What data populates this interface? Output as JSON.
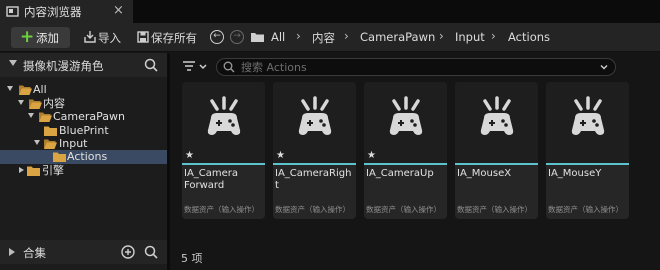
{
  "window": {
    "tab_title": "内容浏览器",
    "tab_icon": "content-browser-icon",
    "close_glyph": "×"
  },
  "toolbar": {
    "add_label": "添加",
    "import_label": "导入",
    "save_all_label": "保存所有",
    "breadcrumbs": [
      "All",
      "内容",
      "CameraPawn",
      "Input",
      "Actions"
    ]
  },
  "sidebar": {
    "title": "摄像机漫游角色",
    "tree": [
      {
        "label": "All",
        "depth": 0,
        "expanded": true,
        "selected": false
      },
      {
        "label": "内容",
        "depth": 1,
        "expanded": true,
        "selected": false
      },
      {
        "label": "CameraPawn",
        "depth": 2,
        "expanded": true,
        "selected": false
      },
      {
        "label": "BluePrint",
        "depth": 3,
        "expanded": null,
        "selected": false
      },
      {
        "label": "Input",
        "depth": 3,
        "expanded": true,
        "selected": false
      },
      {
        "label": "Actions",
        "depth": 4,
        "expanded": null,
        "selected": true
      },
      {
        "label": "引擎",
        "depth": 1,
        "expanded": false,
        "selected": false
      }
    ],
    "footer_title": "合集"
  },
  "content": {
    "search_placeholder": "搜索 Actions",
    "assets": [
      {
        "name": "IA_Camera Forward",
        "type": "数据资产（输入操作）",
        "starred": true
      },
      {
        "name": "IA_CameraRight",
        "type": "数据资产（输入操作）",
        "starred": true
      },
      {
        "name": "IA_CameraUp",
        "type": "数据资产（输入操作）",
        "starred": true
      },
      {
        "name": "IA_MouseX",
        "type": "数据资产（输入操作）",
        "starred": false
      },
      {
        "name": "IA_MouseY",
        "type": "数据资产（输入操作）",
        "starred": false
      }
    ],
    "item_count": "5 项"
  },
  "colors": {
    "accent_cyan": "#5cc3cc",
    "add_green": "#6fcf3e",
    "folder": "#d9a441",
    "selection": "#3a4a62"
  }
}
